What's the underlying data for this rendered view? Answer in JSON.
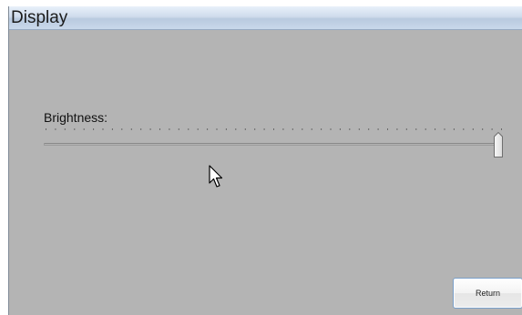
{
  "window": {
    "title": "Display"
  },
  "brightness": {
    "label": "Brightness:",
    "level_fraction": 1.0,
    "tick_count": 49
  },
  "actions": {
    "return_label": "Return"
  },
  "icons": {
    "cursor": "mouse-pointer-icon"
  },
  "colors": {
    "panel_background": "#b4b4b4",
    "titlebar_accent": "#cfdcec"
  }
}
